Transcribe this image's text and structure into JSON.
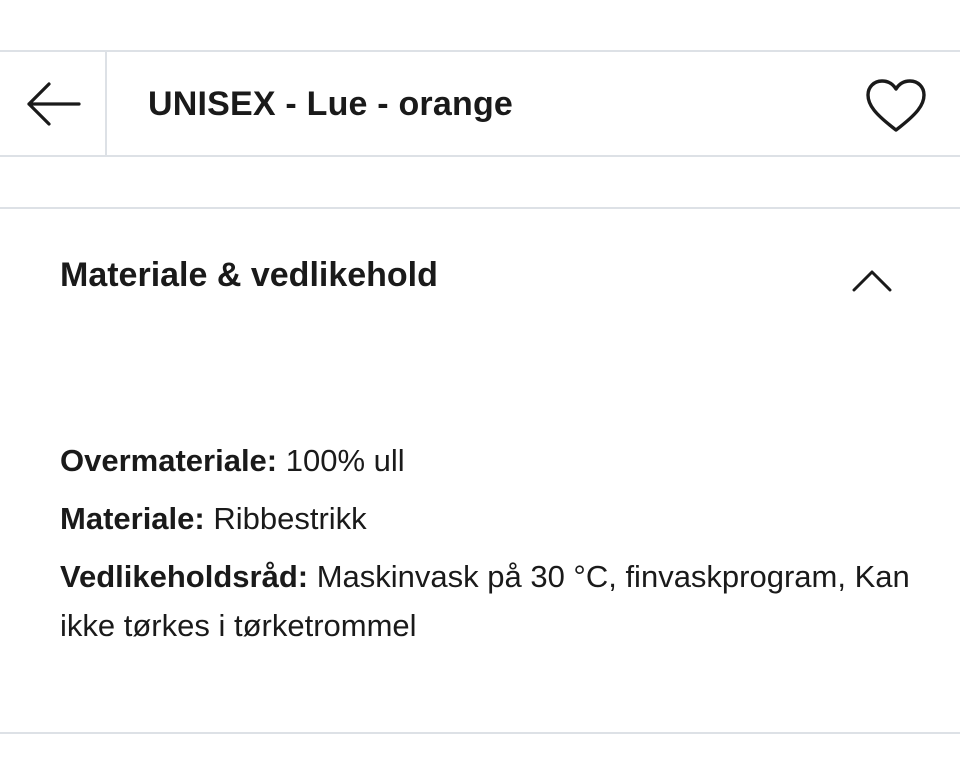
{
  "header": {
    "title": "UNISEX - Lue - orange",
    "back_icon": "arrow-left-icon",
    "favorite_icon": "heart-icon"
  },
  "section": {
    "title": "Materiale & vedlikehold",
    "toggle_icon": "chevron-up-icon",
    "expanded": true
  },
  "details": [
    {
      "label": "Overmateriale:",
      "value": "100% ull"
    },
    {
      "label": "Materiale:",
      "value": "Ribbestrikk"
    },
    {
      "label": "Vedlikeholdsråd:",
      "value": "Maskinvask på 30 °C, finvaskprogram, Kan ikke tørkes i tørketrommel"
    }
  ],
  "colors": {
    "divider": "#dde1e6",
    "text": "#1a1a1a",
    "background": "#ffffff"
  }
}
